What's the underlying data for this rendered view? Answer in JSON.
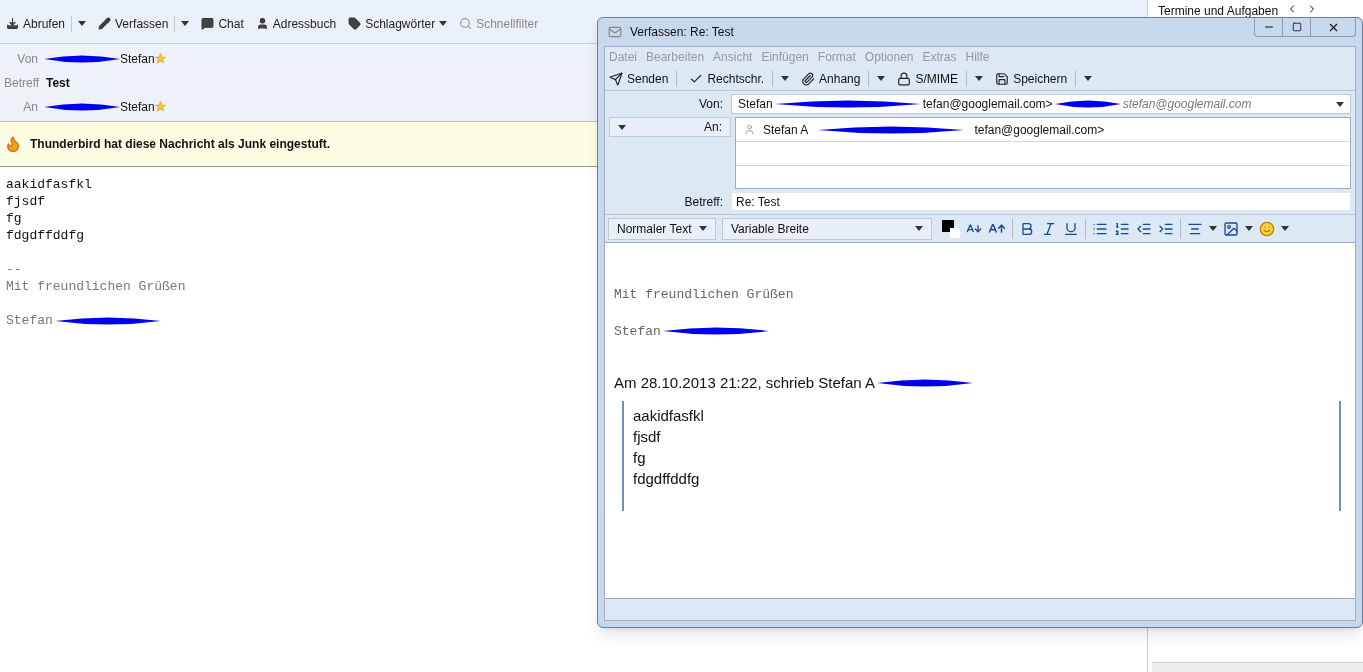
{
  "main_toolbar": [
    {
      "label": "Abrufen",
      "kind": "split",
      "disabled": false
    },
    {
      "label": "Verfassen",
      "kind": "split",
      "disabled": false
    },
    {
      "label": "Chat",
      "kind": "plain",
      "disabled": false
    },
    {
      "label": "Adressbuch",
      "kind": "plain",
      "disabled": false
    },
    {
      "label": "Schlagwörter",
      "kind": "menu",
      "disabled": false
    },
    {
      "label": "Schnellfilter",
      "kind": "plain",
      "disabled": true
    }
  ],
  "message_header": {
    "fields": [
      {
        "label": "Von",
        "value": "Stefan",
        "kind": "contact"
      },
      {
        "label": "Betreff",
        "value": "Test",
        "kind": "subject"
      },
      {
        "label": "An",
        "value": "Stefan",
        "kind": "contact"
      }
    ]
  },
  "junk_notice": "Thunderbird hat diese Nachricht als Junk eingestuft.",
  "message_body": {
    "lines": [
      "aakidfasfkl",
      "fjsdf",
      "fg",
      "fdgdffddfg"
    ],
    "signature": [
      "--",
      "Mit freundlichen Grüßen"
    ],
    "sender": "Stefan"
  },
  "side_panel": {
    "title": "Termine und Aufgaben"
  },
  "compose": {
    "title": "Verfassen: Re: Test",
    "menu": [
      "Datei",
      "Bearbeiten",
      "Ansicht",
      "Einfügen",
      "Format",
      "Optionen",
      "Extras",
      "Hilfe"
    ],
    "toolbar": [
      {
        "label": "Senden",
        "kind": "plain"
      },
      {
        "label": "Rechtschr.",
        "kind": "split"
      },
      {
        "label": "Anhang",
        "kind": "split"
      },
      {
        "label": "S/MIME",
        "kind": "split"
      },
      {
        "label": "Speichern",
        "kind": "split"
      }
    ],
    "from": {
      "label": "Von:",
      "name": "Stefan",
      "address": "tefan@googlemail.com>",
      "identity": "stefan@googlemail.com"
    },
    "to": {
      "label": "An:",
      "name": "Stefan A",
      "address": "tefan@googlemail.com>"
    },
    "subject": {
      "label": "Betreff:",
      "value": "Re: Test"
    },
    "paragraph_format": "Normaler Text",
    "font": "Variable Breite",
    "body": {
      "signature": "Mit freundlichen Grüßen",
      "sender": "Stefan",
      "quote_header": "Am 28.10.2013 21:22, schrieb Stefan A",
      "quote_lines": [
        "aakidfasfkl",
        "fjsdf",
        "fg",
        "fdgdffddfg"
      ]
    }
  }
}
